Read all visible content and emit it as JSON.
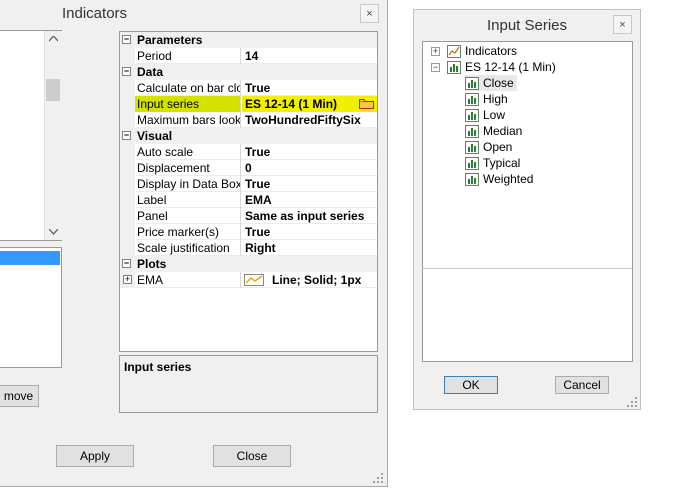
{
  "indicators_window": {
    "title": "Indicators",
    "close_glyph": "×",
    "remove_label": "move",
    "apply_label": "Apply",
    "close_label": "Close"
  },
  "property_grid": {
    "categories": [
      {
        "name": "Parameters",
        "expand": "−",
        "props": [
          {
            "name": "Period",
            "value": "14"
          }
        ]
      },
      {
        "name": "Data",
        "expand": "−",
        "props": [
          {
            "name": "Calculate on bar close",
            "value": "True"
          },
          {
            "name": "Input series",
            "value": "ES 12-14 (1 Min)"
          },
          {
            "name": "Maximum bars look back",
            "value": "TwoHundredFiftySix"
          }
        ]
      },
      {
        "name": "Visual",
        "expand": "−",
        "props": [
          {
            "name": "Auto scale",
            "value": "True"
          },
          {
            "name": "Displacement",
            "value": "0"
          },
          {
            "name": "Display in Data Box",
            "value": "True"
          },
          {
            "name": "Label",
            "value": "EMA"
          },
          {
            "name": "Panel",
            "value": "Same as input series"
          },
          {
            "name": "Price marker(s)",
            "value": "True"
          },
          {
            "name": "Scale justification",
            "value": "Right"
          }
        ]
      },
      {
        "name": "Plots",
        "expand": "−",
        "props": [
          {
            "name": "EMA",
            "value": "Line; Solid; 1px",
            "expand": "+"
          }
        ]
      }
    ],
    "highlight_color": "#f0f000",
    "description_title": "Input series"
  },
  "input_series_dialog": {
    "title": "Input Series",
    "close_glyph": "×",
    "tree": {
      "indicators_label": "Indicators",
      "indicators_expand": "+",
      "instrument_label": "ES 12-14 (1 Min)",
      "instrument_expand": "−",
      "series": [
        "Close",
        "High",
        "Low",
        "Median",
        "Open",
        "Typical",
        "Weighted"
      ]
    },
    "ok_label": "OK",
    "cancel_label": "Cancel"
  }
}
